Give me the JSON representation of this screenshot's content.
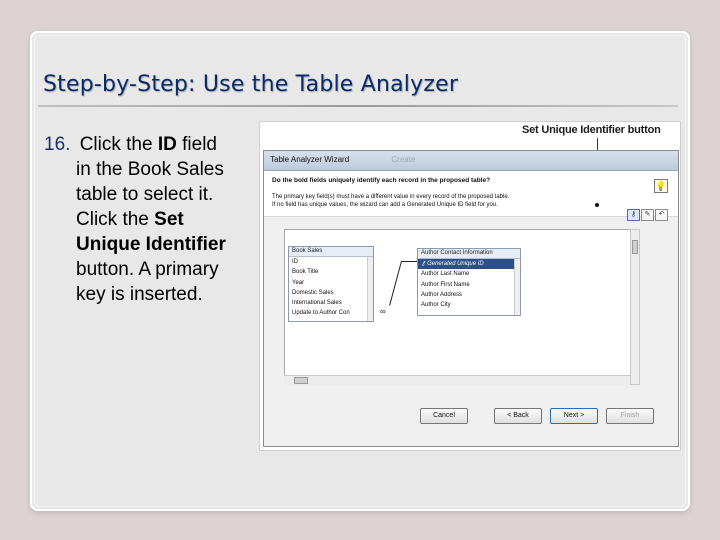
{
  "slide": {
    "title": "Step-by-Step: Use the Table Analyzer",
    "step_number": "16.",
    "step_lines": [
      "Click the ",
      "ID",
      " field",
      "in the Book Sales",
      "table to select it.",
      "Click the ",
      "Set",
      "Unique Identifier",
      "button. A primary",
      "key is inserted."
    ]
  },
  "callout": {
    "label": "Set Unique Identifier button"
  },
  "dialog": {
    "title": "Table Analyzer Wizard",
    "title_ghost": "Create",
    "question": "Do the bold fields uniquely identify each record in the proposed table?",
    "info_line1": "The primary key field(s) must have a different value in every record of the proposed table.",
    "info_line2": "If no field has unique values, the wizard can add a Generated Unique ID field for you.",
    "toolbar": {
      "tips_icon": "lightbulb-icon",
      "key_icon": "key-icon",
      "rename_icon": "rename-icon",
      "undo_icon": "undo-icon"
    },
    "book_sales": {
      "title": "Book Sales",
      "fields": [
        "ID",
        "Book Title",
        "Year",
        "Domestic Sales",
        "International Sales",
        "Update to Author Con"
      ]
    },
    "author_contact": {
      "title": "Author Contact Information",
      "fields": [
        "Generated Unique ID",
        "Author Last Name",
        "Author First Name",
        "Author Address",
        "Author City"
      ]
    },
    "buttons": {
      "cancel": "Cancel",
      "back": "< Back",
      "next": "Next >",
      "finish": "Finish"
    },
    "relationship_symbol": "∞"
  }
}
